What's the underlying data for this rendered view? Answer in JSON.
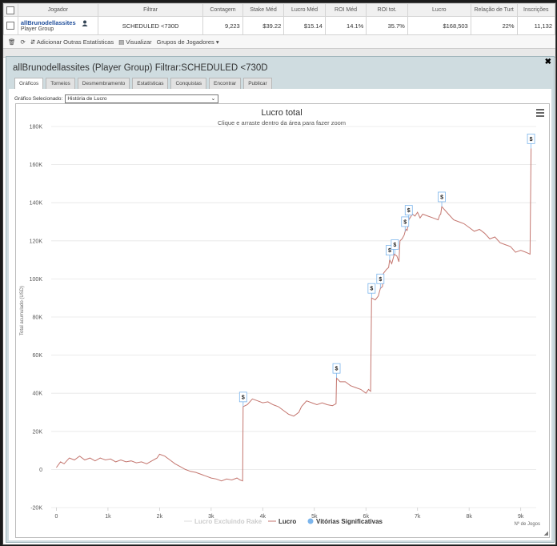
{
  "table": {
    "headers": [
      "Jogador",
      "Filtrar",
      "Contagem",
      "Stake Méd",
      "Lucro Méd",
      "ROI Méd",
      "ROI tot.",
      "Lucro",
      "Relação de Turt",
      "Inscrições"
    ],
    "row": {
      "player": "allBrunodellassites",
      "group": "Player Group",
      "filter": "SCHEDULED <730D",
      "count": "9,223",
      "stake": "$39.22",
      "avg_profit": "$15.14",
      "avg_roi": "14.1%",
      "tot_roi": "35.7%",
      "profit": "$168,503",
      "ratio": "22%",
      "entries": "11,132"
    }
  },
  "toolbar": {
    "add_stats": "Adicionar Outras Estatísticas",
    "view": "Visualizar",
    "groups": "Grupos de Jogadores ▾"
  },
  "panel": {
    "title": "allBrunodellassites (Player Group) Filtrar:SCHEDULED <730D",
    "tabs": [
      "Gráficos",
      "Torneios",
      "Desmembramento",
      "Estatísticas",
      "Conquistas",
      "Encontrar",
      "Publicar"
    ],
    "selected_tab": "Gráficos",
    "chart_select_label": "Gráfico Selecionado:",
    "chart_select_value": "História de Lucro"
  },
  "colors": {
    "line": "#c4766f",
    "marker": "#7cb5ec",
    "grid": "#e6e6e6"
  },
  "chart_data": {
    "type": "line",
    "title": "Lucro total",
    "subtitle": "Clique e arraste dentro da área para fazer zoom",
    "ylabel": "Total acumulado (USD)",
    "xlabel": "Nº de Jogos",
    "ylim": [
      -20000,
      180000
    ],
    "xlim": [
      -100,
      9300
    ],
    "yticks": [
      -20000,
      0,
      20000,
      40000,
      60000,
      80000,
      100000,
      120000,
      140000,
      160000,
      180000
    ],
    "ytick_labels": [
      "-20K",
      "0",
      "20K",
      "40K",
      "60K",
      "80K",
      "100K",
      "120K",
      "140K",
      "160K",
      "180K"
    ],
    "xticks": [
      0,
      1000,
      2000,
      3000,
      4000,
      5000,
      6000,
      7000,
      8000,
      9000
    ],
    "xtick_labels": [
      "0",
      "1k",
      "2k",
      "3k",
      "4k",
      "5k",
      "6k",
      "7k",
      "8k",
      "9k"
    ],
    "legend": [
      "Lucro Excluindo Rake",
      "Lucro",
      "Vitórias Significativas"
    ],
    "series": [
      {
        "name": "Lucro",
        "points": [
          [
            0,
            1000
          ],
          [
            80,
            4000
          ],
          [
            150,
            3000
          ],
          [
            250,
            6000
          ],
          [
            350,
            5000
          ],
          [
            450,
            7000
          ],
          [
            550,
            5000
          ],
          [
            650,
            6000
          ],
          [
            750,
            4500
          ],
          [
            850,
            6000
          ],
          [
            950,
            5000
          ],
          [
            1050,
            5500
          ],
          [
            1150,
            4000
          ],
          [
            1250,
            5000
          ],
          [
            1350,
            4000
          ],
          [
            1450,
            4500
          ],
          [
            1550,
            3500
          ],
          [
            1650,
            4000
          ],
          [
            1750,
            3000
          ],
          [
            1850,
            4500
          ],
          [
            1950,
            6000
          ],
          [
            2000,
            8000
          ],
          [
            2100,
            7000
          ],
          [
            2200,
            5000
          ],
          [
            2300,
            3000
          ],
          [
            2400,
            1500
          ],
          [
            2500,
            0
          ],
          [
            2600,
            -1000
          ],
          [
            2700,
            -1500
          ],
          [
            2800,
            -2500
          ],
          [
            2900,
            -3500
          ],
          [
            3000,
            -4500
          ],
          [
            3100,
            -5000
          ],
          [
            3200,
            -6000
          ],
          [
            3300,
            -5000
          ],
          [
            3400,
            -5500
          ],
          [
            3500,
            -4500
          ],
          [
            3560,
            -5500
          ],
          [
            3610,
            -6000
          ],
          [
            3620,
            33000
          ],
          [
            3700,
            34000
          ],
          [
            3800,
            37000
          ],
          [
            3900,
            36000
          ],
          [
            4000,
            35000
          ],
          [
            4100,
            35500
          ],
          [
            4200,
            34000
          ],
          [
            4300,
            33000
          ],
          [
            4400,
            31000
          ],
          [
            4500,
            29000
          ],
          [
            4600,
            28000
          ],
          [
            4700,
            30000
          ],
          [
            4750,
            33000
          ],
          [
            4850,
            36000
          ],
          [
            4950,
            35000
          ],
          [
            5050,
            34000
          ],
          [
            5150,
            35000
          ],
          [
            5250,
            34000
          ],
          [
            5350,
            33500
          ],
          [
            5420,
            34500
          ],
          [
            5430,
            48000
          ],
          [
            5500,
            46000
          ],
          [
            5600,
            46000
          ],
          [
            5700,
            44000
          ],
          [
            5800,
            43000
          ],
          [
            5900,
            42000
          ],
          [
            6000,
            40000
          ],
          [
            6050,
            42000
          ],
          [
            6090,
            41000
          ],
          [
            6110,
            90000
          ],
          [
            6180,
            89000
          ],
          [
            6240,
            91000
          ],
          [
            6280,
            95000
          ],
          [
            6320,
            96000
          ],
          [
            6340,
            103000
          ],
          [
            6400,
            105000
          ],
          [
            6440,
            106000
          ],
          [
            6460,
            110000
          ],
          [
            6500,
            108000
          ],
          [
            6550,
            113000
          ],
          [
            6600,
            112000
          ],
          [
            6640,
            109000
          ],
          [
            6660,
            120000
          ],
          [
            6700,
            121000
          ],
          [
            6740,
            123000
          ],
          [
            6760,
            125000
          ],
          [
            6780,
            126000
          ],
          [
            6800,
            125500
          ],
          [
            6830,
            131000
          ],
          [
            6900,
            134000
          ],
          [
            6950,
            133000
          ],
          [
            7000,
            135000
          ],
          [
            7050,
            132000
          ],
          [
            7100,
            134000
          ],
          [
            7200,
            133000
          ],
          [
            7300,
            132000
          ],
          [
            7400,
            131000
          ],
          [
            7430,
            133500
          ],
          [
            7450,
            134000
          ],
          [
            7470,
            138000
          ],
          [
            7500,
            137000
          ],
          [
            7600,
            134000
          ],
          [
            7700,
            131000
          ],
          [
            7800,
            130000
          ],
          [
            7900,
            129000
          ],
          [
            8000,
            127000
          ],
          [
            8100,
            125000
          ],
          [
            8200,
            126000
          ],
          [
            8300,
            124000
          ],
          [
            8400,
            121000
          ],
          [
            8500,
            122000
          ],
          [
            8600,
            119000
          ],
          [
            8700,
            118000
          ],
          [
            8800,
            117000
          ],
          [
            8900,
            114000
          ],
          [
            9000,
            115000
          ],
          [
            9100,
            114000
          ],
          [
            9180,
            113000
          ],
          [
            9200,
            168500
          ]
        ]
      }
    ],
    "significant_wins": [
      {
        "x": 3620,
        "y": 33000
      },
      {
        "x": 5430,
        "y": 48000
      },
      {
        "x": 6110,
        "y": 90000
      },
      {
        "x": 6280,
        "y": 95000
      },
      {
        "x": 6460,
        "y": 110000
      },
      {
        "x": 6560,
        "y": 113000
      },
      {
        "x": 6760,
        "y": 125000
      },
      {
        "x": 6830,
        "y": 131000
      },
      {
        "x": 7470,
        "y": 138000
      },
      {
        "x": 9200,
        "y": 168500
      }
    ],
    "marker_label": "$"
  }
}
